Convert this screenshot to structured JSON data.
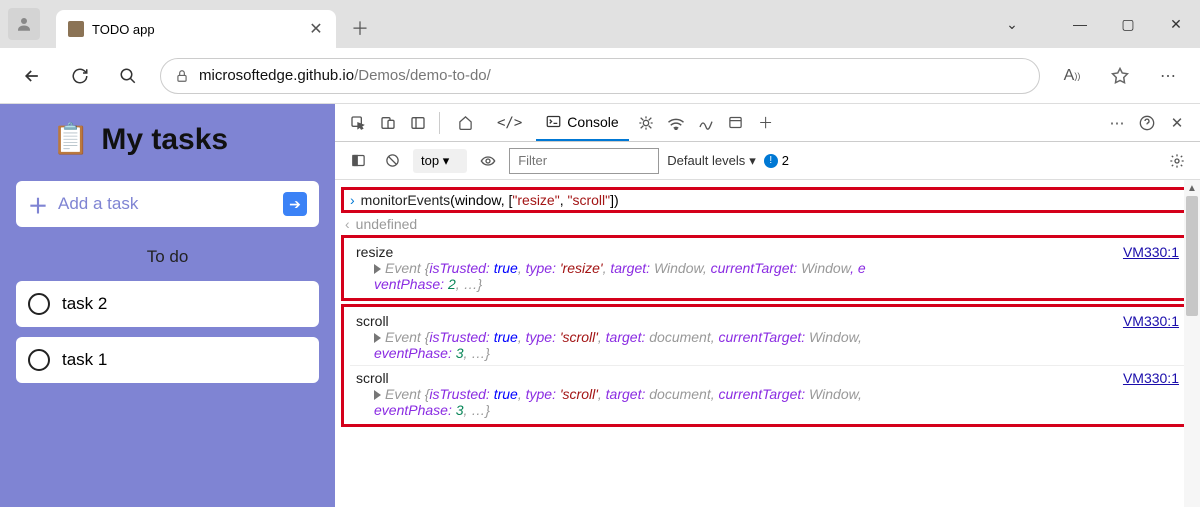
{
  "browser": {
    "tab_title": "TODO app",
    "url_host": "microsoftedge.github.io",
    "url_path": "/Demos/demo-to-do/"
  },
  "app": {
    "title": "My tasks",
    "add_task_label": "Add a task",
    "section_label": "To do",
    "tasks": [
      "task 2",
      "task 1"
    ]
  },
  "devtools": {
    "console_tab": "Console",
    "context": "top",
    "filter_placeholder": "Filter",
    "levels_label": "Default levels",
    "issue_count": "2",
    "settings_gear": "⚙"
  },
  "console": {
    "cmd_prefix": "monitorEvents",
    "cmd_args_open": "(window, [",
    "cmd_str1": "\"resize\"",
    "cmd_sep": ", ",
    "cmd_str2": "\"scroll\"",
    "cmd_args_close": "])",
    "ret_val": "undefined",
    "link": "VM330:1",
    "events": [
      {
        "name": "resize",
        "detail_pre": "Event {",
        "k1": "isTrusted:",
        "v1": "true",
        "k2": "type:",
        "v2": "'resize'",
        "k3": "target:",
        "v3": "Window",
        "k4": "currentTarget:",
        "v4": "Window",
        "k5_line2": "ventPhase:",
        "v5": "2",
        "trail": ", …}",
        "e_trail": ", e"
      },
      {
        "name": "scroll",
        "detail_pre": "Event {",
        "k1": "isTrusted:",
        "v1": "true",
        "k2": "type:",
        "v2": "'scroll'",
        "k3": "target:",
        "v3": "document",
        "k4": "currentTarget:",
        "v4": "Window",
        "k5_line2": "eventPhase:",
        "v5": "3",
        "trail": ", …}"
      },
      {
        "name": "scroll",
        "detail_pre": "Event {",
        "k1": "isTrusted:",
        "v1": "true",
        "k2": "type:",
        "v2": "'scroll'",
        "k3": "target:",
        "v3": "document",
        "k4": "currentTarget:",
        "v4": "Window",
        "k5_line2": "eventPhase:",
        "v5": "3",
        "trail": ", …}"
      }
    ]
  }
}
